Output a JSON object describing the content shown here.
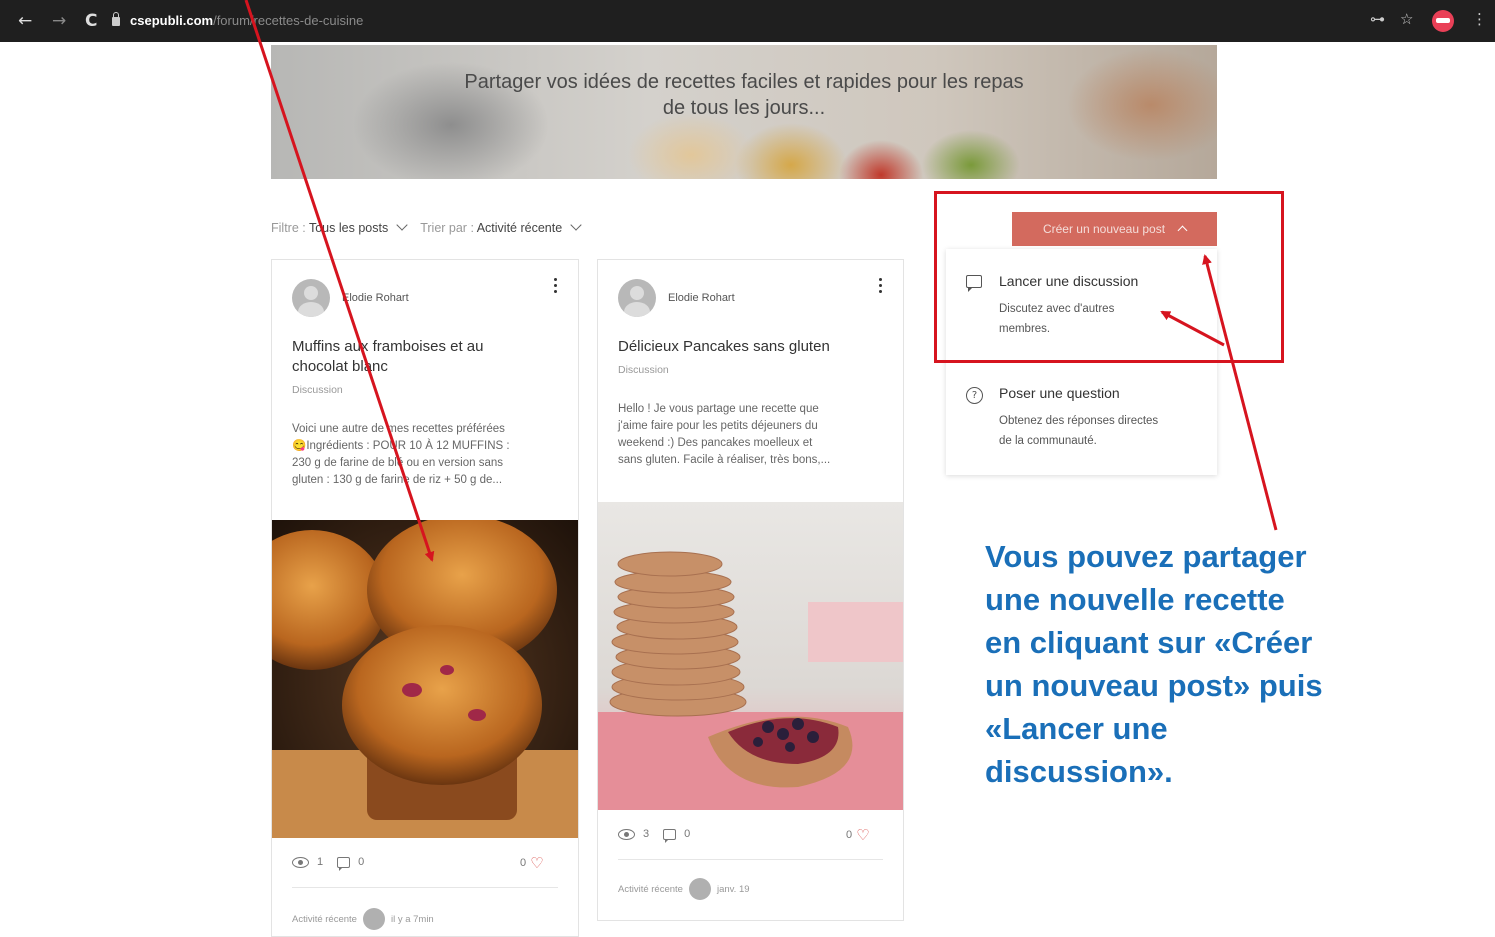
{
  "browser": {
    "back_glyph": "←",
    "forward_glyph": "→",
    "reload_glyph": "C",
    "url_host": "csepubli.com",
    "url_path": "/forum/recettes-de-cuisine",
    "key_glyph": "⊶",
    "star_glyph": "☆",
    "menu_glyph": "⋮"
  },
  "hero": {
    "title_line1": "Partager vos idées de recettes faciles et rapides pour les repas",
    "title_line2": "de tous les jours..."
  },
  "filters": {
    "filter_label": "Filtre : ",
    "filter_value": "Tous les posts",
    "sort_label": "Trier par : ",
    "sort_value": "Activité récente"
  },
  "posts": [
    {
      "author": "Elodie Rohart",
      "title_line1": "Muffins aux framboises et au",
      "title_line2": "chocolat blanc",
      "category": "Discussion",
      "excerpt": [
        "Voici une autre de mes recettes préférées",
        "😋Ingrédients : POUR 10 À 12 MUFFINS :",
        "230 g de farine de blé ou en version sans",
        "gluten : 130 g de farine de riz + 50 g de..."
      ],
      "views": "1",
      "comments": "0",
      "likes": "0",
      "activity_label": "Activité récente",
      "activity_time": "il y a 7min"
    },
    {
      "author": "Elodie Rohart",
      "title_line1": "Délicieux Pancakes sans gluten",
      "category": "Discussion",
      "excerpt": [
        "Hello ! Je vous partage une recette que",
        "j'aime faire pour les petits déjeuners du",
        "weekend :) Des pancakes moelleux et",
        "sans gluten. Facile à réaliser, très bons,..."
      ],
      "views": "3",
      "comments": "0",
      "likes": "0",
      "activity_label": "Activité récente",
      "activity_time": "janv. 19"
    }
  ],
  "create_post": {
    "button_label": "Créer un nouveau post",
    "items": [
      {
        "label": "Lancer une discussion",
        "desc_line1": "Discutez avec d'autres",
        "desc_line2": "membres."
      },
      {
        "label": "Poser une question",
        "desc_line1": "Obtenez des réponses directes",
        "desc_line2": "de la communauté.",
        "icon_glyph": "?"
      }
    ]
  },
  "annotation": {
    "lines": [
      "Vous pouvez partager",
      "une nouvelle recette",
      "en cliquant sur «Créer",
      "un nouveau post» puis",
      "«Lancer une",
      "discussion»."
    ]
  },
  "colors": {
    "accent_button": "#d36a5e",
    "annotation_red": "#d6141f",
    "annotation_blue": "#1a6fb8",
    "like_heart": "#d9534f"
  }
}
